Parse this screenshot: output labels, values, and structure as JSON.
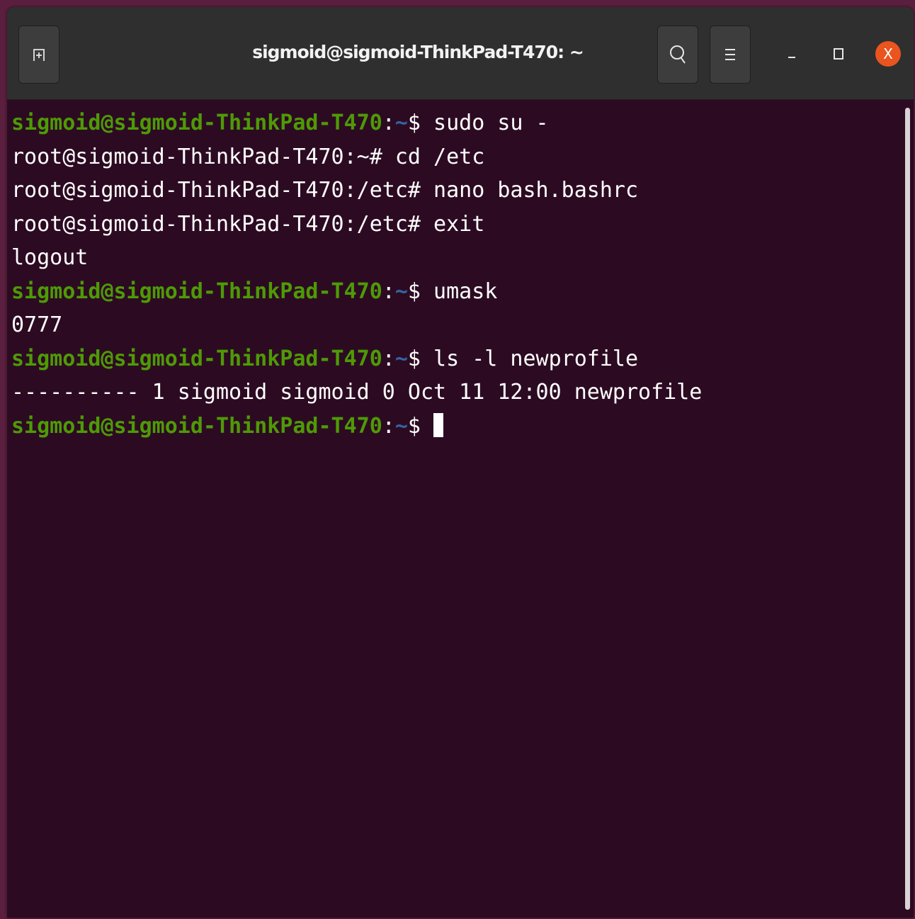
{
  "window": {
    "title": "sigmoid@sigmoid-ThinkPad-T470: ~",
    "close_label": "X"
  },
  "colors": {
    "background": "#2c0b22",
    "prompt_user": "#4e9a06",
    "prompt_path": "#3465a4",
    "close_button": "#e9541f"
  },
  "icons": {
    "new_tab": "new-tab-icon",
    "search": "search-icon",
    "menu": "hamburger-menu-icon",
    "minimize": "minimize-icon",
    "maximize": "maximize-icon",
    "close": "close-icon"
  },
  "terminal": {
    "lines": [
      {
        "user": "sigmoid@sigmoid-ThinkPad-T470",
        "sep": ":",
        "path": "~",
        "sym": "$ ",
        "cmd": "sudo su -"
      },
      {
        "text": "root@sigmoid-ThinkPad-T470:~# cd /etc"
      },
      {
        "text": "root@sigmoid-ThinkPad-T470:/etc# nano bash.bashrc"
      },
      {
        "text": "root@sigmoid-ThinkPad-T470:/etc# exit"
      },
      {
        "text": "logout"
      },
      {
        "user": "sigmoid@sigmoid-ThinkPad-T470",
        "sep": ":",
        "path": "~",
        "sym": "$ ",
        "cmd": "umask"
      },
      {
        "text": "0777"
      },
      {
        "user": "sigmoid@sigmoid-ThinkPad-T470",
        "sep": ":",
        "path": "~",
        "sym": "$ ",
        "cmd": "ls -l newprofile"
      },
      {
        "text": "---------- 1 sigmoid sigmoid 0 Oct 11 12:00 newprofile"
      },
      {
        "user": "sigmoid@sigmoid-ThinkPad-T470",
        "sep": ":",
        "path": "~",
        "sym": "$ ",
        "cmd": ""
      }
    ]
  }
}
